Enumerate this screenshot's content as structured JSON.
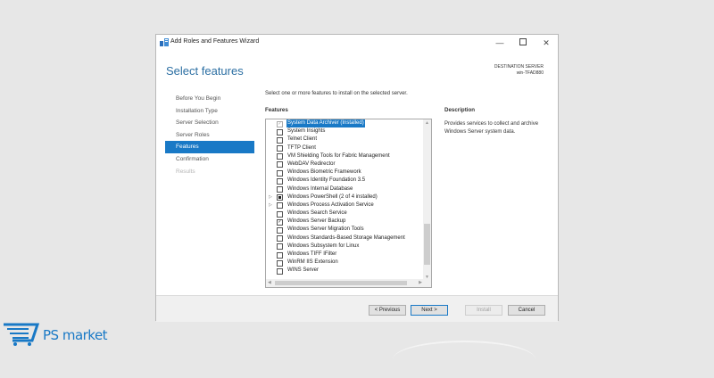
{
  "window": {
    "title": "Add Roles and Features Wizard",
    "controls": {
      "minimize": "—",
      "maximize": "",
      "close": "✕"
    }
  },
  "page": {
    "heading": "Select features",
    "destination_label": "DESTINATION SERVER",
    "destination_server": "win-TFAD880",
    "instruction": "Select one or more features to install on the selected server."
  },
  "nav": {
    "items": [
      {
        "label": "Before You Begin",
        "state": "normal"
      },
      {
        "label": "Installation Type",
        "state": "normal"
      },
      {
        "label": "Server Selection",
        "state": "normal"
      },
      {
        "label": "Server Roles",
        "state": "normal"
      },
      {
        "label": "Features",
        "state": "active"
      },
      {
        "label": "Confirmation",
        "state": "normal"
      },
      {
        "label": "Results",
        "state": "disabled"
      }
    ]
  },
  "features": {
    "label": "Features",
    "items": [
      {
        "label": "System Data Archiver (Installed)",
        "state": "checked-disabled",
        "selected": true,
        "expandable": false
      },
      {
        "label": "System Insights",
        "state": "unchecked",
        "expandable": false
      },
      {
        "label": "Telnet Client",
        "state": "unchecked",
        "expandable": false
      },
      {
        "label": "TFTP Client",
        "state": "unchecked",
        "expandable": false
      },
      {
        "label": "VM Shielding Tools for Fabric Management",
        "state": "unchecked",
        "expandable": false
      },
      {
        "label": "WebDAV Redirector",
        "state": "unchecked",
        "expandable": false
      },
      {
        "label": "Windows Biometric Framework",
        "state": "unchecked",
        "expandable": false
      },
      {
        "label": "Windows Identity Foundation 3.5",
        "state": "unchecked",
        "expandable": false
      },
      {
        "label": "Windows Internal Database",
        "state": "unchecked",
        "expandable": false
      },
      {
        "label": "Windows PowerShell (2 of 4 installed)",
        "state": "partial",
        "expandable": true
      },
      {
        "label": "Windows Process Activation Service",
        "state": "unchecked",
        "expandable": true
      },
      {
        "label": "Windows Search Service",
        "state": "unchecked",
        "expandable": false
      },
      {
        "label": "Windows Server Backup",
        "state": "checked",
        "expandable": false
      },
      {
        "label": "Windows Server Migration Tools",
        "state": "unchecked",
        "expandable": false
      },
      {
        "label": "Windows Standards-Based Storage Management",
        "state": "unchecked",
        "expandable": false
      },
      {
        "label": "Windows Subsystem for Linux",
        "state": "unchecked",
        "expandable": false
      },
      {
        "label": "Windows TIFF IFilter",
        "state": "unchecked",
        "expandable": false
      },
      {
        "label": "WinRM IIS Extension",
        "state": "unchecked",
        "expandable": false
      },
      {
        "label": "WINS Server",
        "state": "unchecked",
        "expandable": false
      }
    ]
  },
  "description": {
    "label": "Description",
    "text": "Provides services to collect and archive Windows Server system data."
  },
  "buttons": {
    "previous": "< Previous",
    "next": "Next >",
    "install": "Install",
    "cancel": "Cancel"
  },
  "watermark": {
    "brand": "PS market"
  },
  "colors": {
    "accent": "#1979c6",
    "heading": "#2c6fa3"
  }
}
